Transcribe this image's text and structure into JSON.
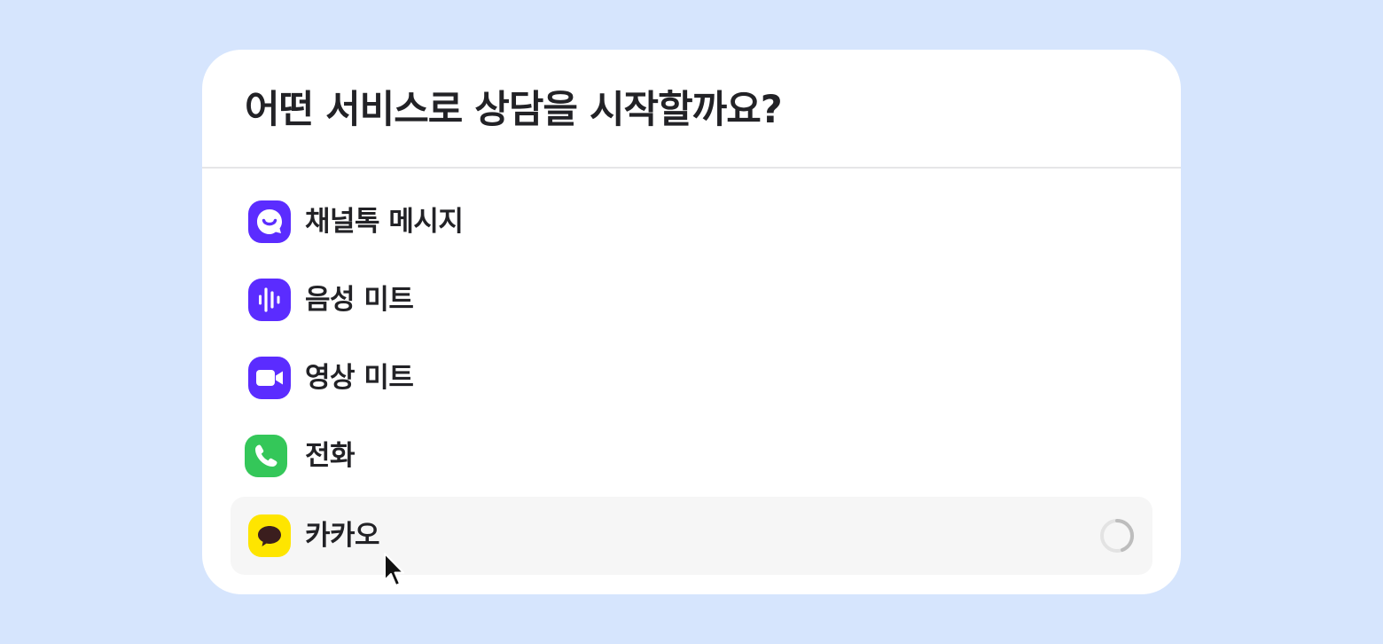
{
  "dialog": {
    "title": "어떤 서비스로 상담을 시작할까요?"
  },
  "options": [
    {
      "label": "채널톡 메시지",
      "icon": "chat-bubble-icon",
      "color": "#5b2cff"
    },
    {
      "label": "음성 미트",
      "icon": "audio-wave-icon",
      "color": "#5b2cff"
    },
    {
      "label": "영상 미트",
      "icon": "video-camera-icon",
      "color": "#5b2cff"
    },
    {
      "label": "전화",
      "icon": "phone-icon",
      "color": "#34c759"
    },
    {
      "label": "카카오",
      "icon": "kakao-speech-bubble-icon",
      "color": "#fee500",
      "selected": true,
      "status": "loading"
    }
  ],
  "colors": {
    "background": "#d6e5fd",
    "card": "#ffffff",
    "selected_row": "#f6f6f6",
    "text": "#222226",
    "spinner_track": "#e3e3e3",
    "spinner_arc": "#bdbdbd"
  }
}
